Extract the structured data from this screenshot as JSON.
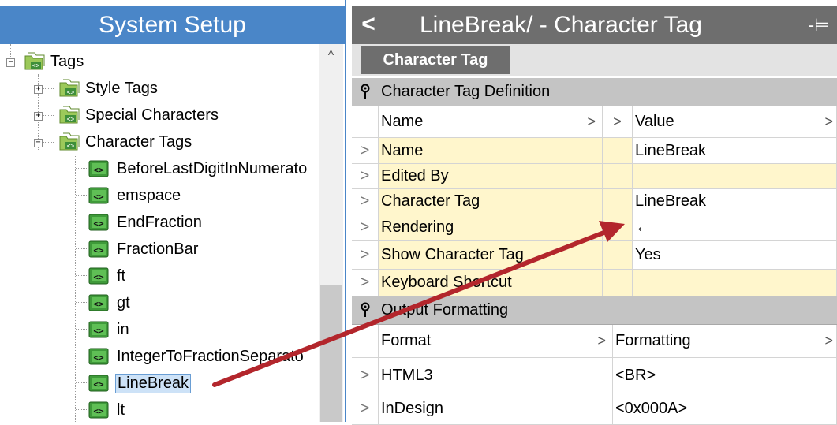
{
  "left_panel": {
    "title": "System Setup",
    "tree": {
      "tags": {
        "label": "Tags",
        "expander": "−"
      },
      "style_tags": {
        "label": "Style Tags",
        "expander": "+"
      },
      "special_characters": {
        "label": "Special Characters",
        "expander": "+"
      },
      "character_tags": {
        "label": "Character Tags",
        "expander": "−"
      },
      "items": [
        {
          "label": "BeforeLastDigitInNumerato",
          "selected": false
        },
        {
          "label": "emspace",
          "selected": false
        },
        {
          "label": "EndFraction",
          "selected": false
        },
        {
          "label": "FractionBar",
          "selected": false
        },
        {
          "label": "ft",
          "selected": false
        },
        {
          "label": "gt",
          "selected": false
        },
        {
          "label": "in",
          "selected": false
        },
        {
          "label": "IntegerToFractionSeparato",
          "selected": false
        },
        {
          "label": "LineBreak",
          "selected": true
        },
        {
          "label": "lt",
          "selected": false
        }
      ]
    },
    "scroll_up_glyph": "^"
  },
  "right_panel": {
    "back_glyph": "<",
    "title": "LineBreak/ - Character Tag",
    "pin_glyph": "-⊨",
    "active_tab": "Character Tag",
    "sections": {
      "definition": {
        "title": "Character Tag Definition",
        "header": {
          "name": "Name",
          "value": "Value"
        },
        "rows": [
          {
            "name": "Name",
            "value": "LineBreak"
          },
          {
            "name": "Edited By",
            "value": ""
          },
          {
            "name": "Character Tag",
            "value": "LineBreak"
          },
          {
            "name": "Rendering",
            "value": "←"
          },
          {
            "name": "Show Character Tag",
            "value": "Yes"
          },
          {
            "name": "Keyboard Shortcut",
            "value": ""
          }
        ]
      },
      "output": {
        "title": "Output Formatting",
        "header": {
          "format": "Format",
          "formatting": "Formatting"
        },
        "rows": [
          {
            "format": "HTML3",
            "formatting": "<BR>"
          },
          {
            "format": "InDesign",
            "formatting": "<0x000A>"
          }
        ]
      }
    },
    "expander_glyph": ">",
    "chevron_glyph": ">"
  },
  "colors": {
    "left_title_bg": "#4a86c8",
    "right_title_bg": "#6e6e6e",
    "row_highlight": "#fff6cc",
    "annotation_arrow": "#b3262c"
  }
}
